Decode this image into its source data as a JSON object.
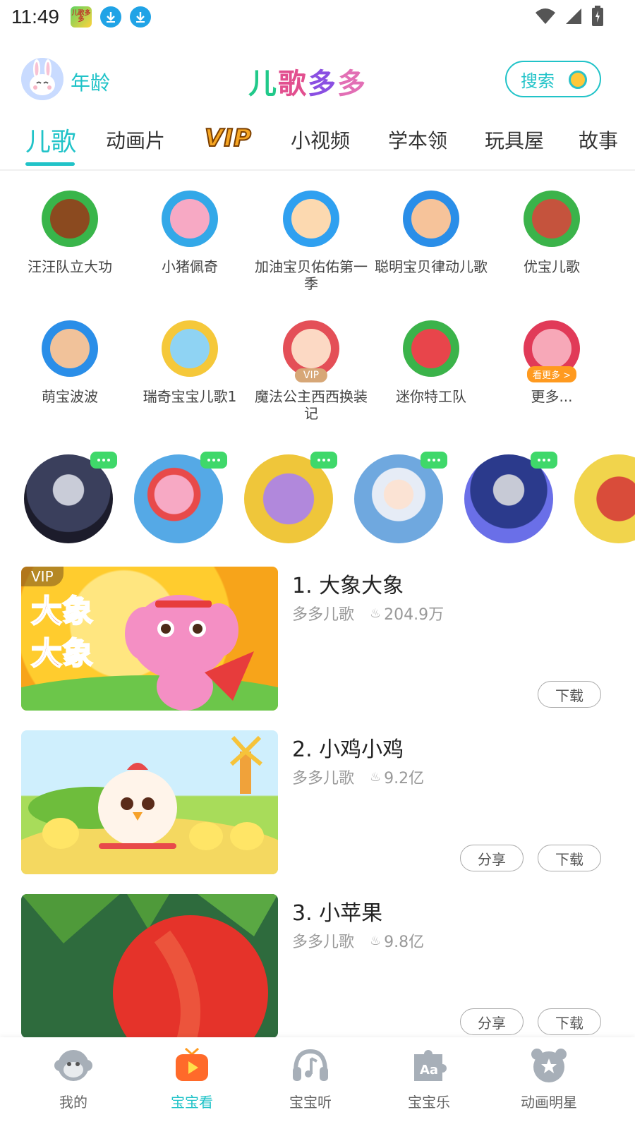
{
  "status": {
    "time": "11:49",
    "app_mini_text": "儿歌多多"
  },
  "header": {
    "age_label": "年龄",
    "logo": [
      "儿",
      "歌",
      "多",
      "多"
    ],
    "search_label": "搜索"
  },
  "tabs": [
    {
      "label": "儿歌",
      "active": true
    },
    {
      "label": "动画片"
    },
    {
      "label": "VIP"
    },
    {
      "label": "小视频"
    },
    {
      "label": "学本领"
    },
    {
      "label": "玩具屋"
    },
    {
      "label": "故事"
    }
  ],
  "categories": [
    {
      "label": "汪汪队立大功",
      "icon": "paw-patrol-chase-icon",
      "bg": "#39b54a",
      "face": "#8b4a1f"
    },
    {
      "label": "小猪佩奇",
      "icon": "peppa-pig-icon",
      "bg": "#33a8e8",
      "face": "#f7a9c4"
    },
    {
      "label": "加油宝贝佑佑第一季",
      "icon": "baby-boy-icon",
      "bg": "#2fa0f0",
      "face": "#fcd9b0"
    },
    {
      "label": "聪明宝贝律动儿歌",
      "icon": "baby-icon",
      "bg": "#2a8ee8",
      "face": "#f6c39a"
    },
    {
      "label": "优宝儿歌",
      "icon": "fox-girl-icon",
      "bg": "#3bb34a",
      "face": "#c5533d"
    },
    {
      "label": "萌宝波波",
      "icon": "boy-icon",
      "bg": "#2a8ee8",
      "face": "#f1c29a"
    },
    {
      "label": "瑞奇宝宝儿歌1",
      "icon": "bunny-icon",
      "bg": "#f5c83a",
      "face": "#8fd3f3"
    },
    {
      "label": "魔法公主西西换装记",
      "icon": "princess-icon",
      "bg": "#e44f57",
      "face": "#fcd9c4",
      "vip": "VIP"
    },
    {
      "label": "迷你特工队",
      "icon": "owl-icon",
      "bg": "#3bb34a",
      "face": "#e8454b"
    },
    {
      "label": "更多...",
      "icon": "pig-more-icon",
      "bg": "#e13a58",
      "face": "#f7a8b8",
      "more": "看更多 >"
    }
  ],
  "stars": [
    {
      "name": "ultraman-zero",
      "bg": "#1c1c2b"
    },
    {
      "name": "peppa",
      "bg": "#55a9e6"
    },
    {
      "name": "pony",
      "bg": "#efc63a"
    },
    {
      "name": "elsa",
      "bg": "#6fa8df"
    },
    {
      "name": "ultraman",
      "bg": "#6a6fe8"
    },
    {
      "name": "robot",
      "bg": "#f1d44c"
    }
  ],
  "songs": [
    {
      "title": "1. 大象大象",
      "author": "多多儿歌",
      "plays": "204.9万",
      "vip": "VIP",
      "thumb_text": "大象 大象",
      "buttons": [
        "下载"
      ]
    },
    {
      "title": "2. 小鸡小鸡",
      "author": "多多儿歌",
      "plays": "9.2亿",
      "buttons": [
        "分享",
        "下载"
      ]
    },
    {
      "title": "3. 小苹果",
      "author": "多多儿歌",
      "plays": "9.8亿",
      "buttons": [
        "分享",
        "下载"
      ]
    }
  ],
  "song_buttons": {
    "share": "分享",
    "download": "下载"
  },
  "nav": [
    {
      "label": "我的",
      "icon": "monkey-icon"
    },
    {
      "label": "宝宝看",
      "icon": "tv-play-icon",
      "active": true
    },
    {
      "label": "宝宝听",
      "icon": "headphones-icon"
    },
    {
      "label": "宝宝乐",
      "icon": "puzzle-icon"
    },
    {
      "label": "动画明星",
      "icon": "bear-star-icon"
    }
  ],
  "colors": {
    "accent": "#21c3c8",
    "vip_gold": "#f6a623",
    "bubble_green": "#3fd86a"
  }
}
